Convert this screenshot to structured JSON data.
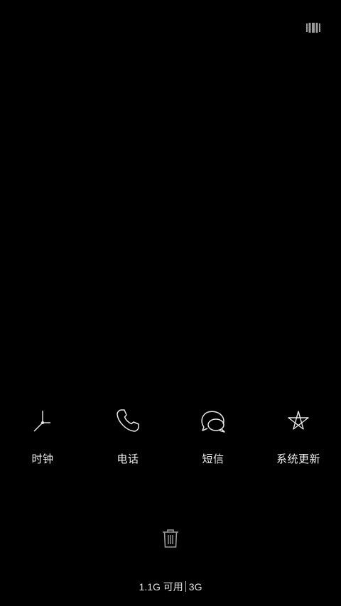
{
  "topbar": {
    "menu_icon": "vertical-bars-icon"
  },
  "apps": [
    {
      "label": "时钟",
      "icon": "clock-icon"
    },
    {
      "label": "电话",
      "icon": "phone-icon"
    },
    {
      "label": "短信",
      "icon": "message-icon"
    },
    {
      "label": "系统更新",
      "icon": "star-icon"
    }
  ],
  "clear_button": {
    "icon": "trash-icon"
  },
  "memory": {
    "available": "1.1G 可用",
    "total": "3G"
  },
  "colors": {
    "background": "#000000",
    "foreground": "#e6e6e6"
  }
}
